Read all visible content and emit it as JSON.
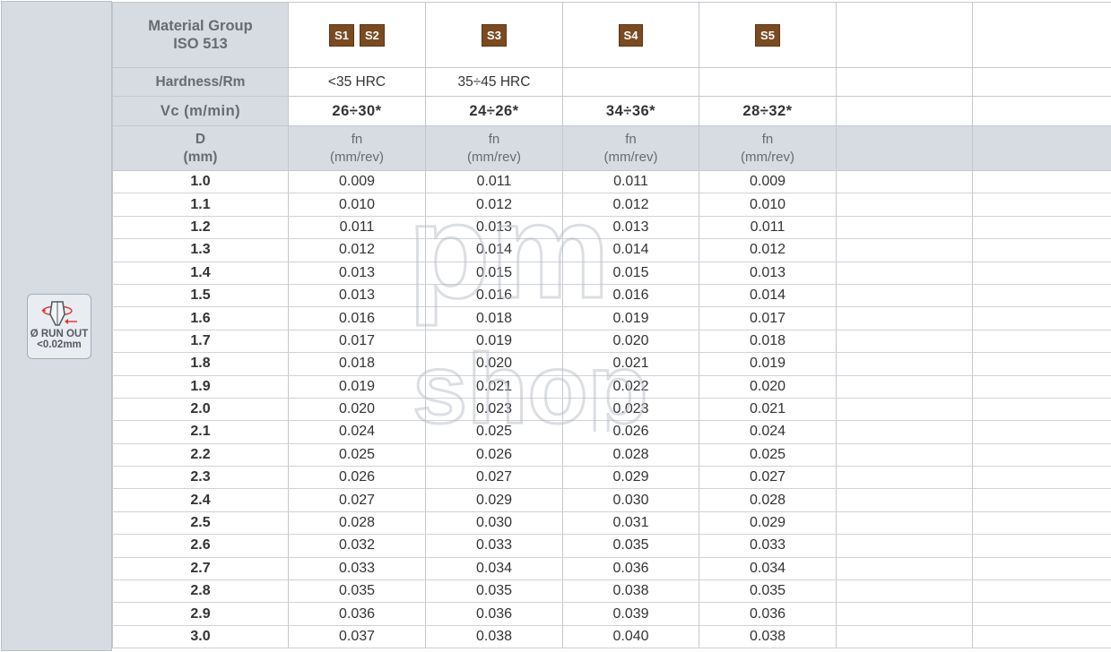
{
  "sidebar": {
    "icon": "drill-runout-icon",
    "runout_line1": "Ø RUN OUT",
    "runout_line2": "<0.02mm"
  },
  "header": {
    "material_label": "Material Group\nISO 513",
    "badges": {
      "col1": [
        "S1",
        "S2"
      ],
      "col2": [
        "S3"
      ],
      "col3": [
        "S4"
      ],
      "col4": [
        "S5"
      ]
    },
    "badge_color": "#7a4a21",
    "hardness_label": "Hardness/Rm",
    "hardness": [
      "<35 HRC",
      "35÷45 HRC",
      "",
      ""
    ],
    "vc_label": "Vc (m/min)",
    "vc": [
      "26÷30*",
      "24÷26*",
      "34÷36*",
      "28÷32*"
    ],
    "d_label": "D\n(mm)",
    "fn_label": "fn\n(mm/rev)"
  },
  "rows": [
    {
      "d": "1.0",
      "v": [
        "0.009",
        "0.011",
        "0.011",
        "0.009"
      ]
    },
    {
      "d": "1.1",
      "v": [
        "0.010",
        "0.012",
        "0.012",
        "0.010"
      ]
    },
    {
      "d": "1.2",
      "v": [
        "0.011",
        "0.013",
        "0.013",
        "0.011"
      ]
    },
    {
      "d": "1.3",
      "v": [
        "0.012",
        "0.014",
        "0.014",
        "0.012"
      ]
    },
    {
      "d": "1.4",
      "v": [
        "0.013",
        "0.015",
        "0.015",
        "0.013"
      ]
    },
    {
      "d": "1.5",
      "v": [
        "0.013",
        "0.016",
        "0.016",
        "0.014"
      ]
    },
    {
      "d": "1.6",
      "v": [
        "0.016",
        "0.018",
        "0.019",
        "0.017"
      ]
    },
    {
      "d": "1.7",
      "v": [
        "0.017",
        "0.019",
        "0.020",
        "0.018"
      ]
    },
    {
      "d": "1.8",
      "v": [
        "0.018",
        "0.020",
        "0.021",
        "0.019"
      ]
    },
    {
      "d": "1.9",
      "v": [
        "0.019",
        "0.021",
        "0.022",
        "0.020"
      ]
    },
    {
      "d": "2.0",
      "v": [
        "0.020",
        "0.023",
        "0.023",
        "0.021"
      ]
    },
    {
      "d": "2.1",
      "v": [
        "0.024",
        "0.025",
        "0.026",
        "0.024"
      ]
    },
    {
      "d": "2.2",
      "v": [
        "0.025",
        "0.026",
        "0.028",
        "0.025"
      ]
    },
    {
      "d": "2.3",
      "v": [
        "0.026",
        "0.027",
        "0.029",
        "0.027"
      ]
    },
    {
      "d": "2.4",
      "v": [
        "0.027",
        "0.029",
        "0.030",
        "0.028"
      ]
    },
    {
      "d": "2.5",
      "v": [
        "0.028",
        "0.030",
        "0.031",
        "0.029"
      ]
    },
    {
      "d": "2.6",
      "v": [
        "0.032",
        "0.033",
        "0.035",
        "0.033"
      ]
    },
    {
      "d": "2.7",
      "v": [
        "0.033",
        "0.034",
        "0.036",
        "0.034"
      ]
    },
    {
      "d": "2.8",
      "v": [
        "0.035",
        "0.035",
        "0.038",
        "0.035"
      ]
    },
    {
      "d": "2.9",
      "v": [
        "0.036",
        "0.036",
        "0.039",
        "0.036"
      ]
    },
    {
      "d": "3.0",
      "v": [
        "0.037",
        "0.038",
        "0.040",
        "0.038"
      ]
    }
  ],
  "watermark": {
    "line1": "pm",
    "line2": "shop"
  }
}
